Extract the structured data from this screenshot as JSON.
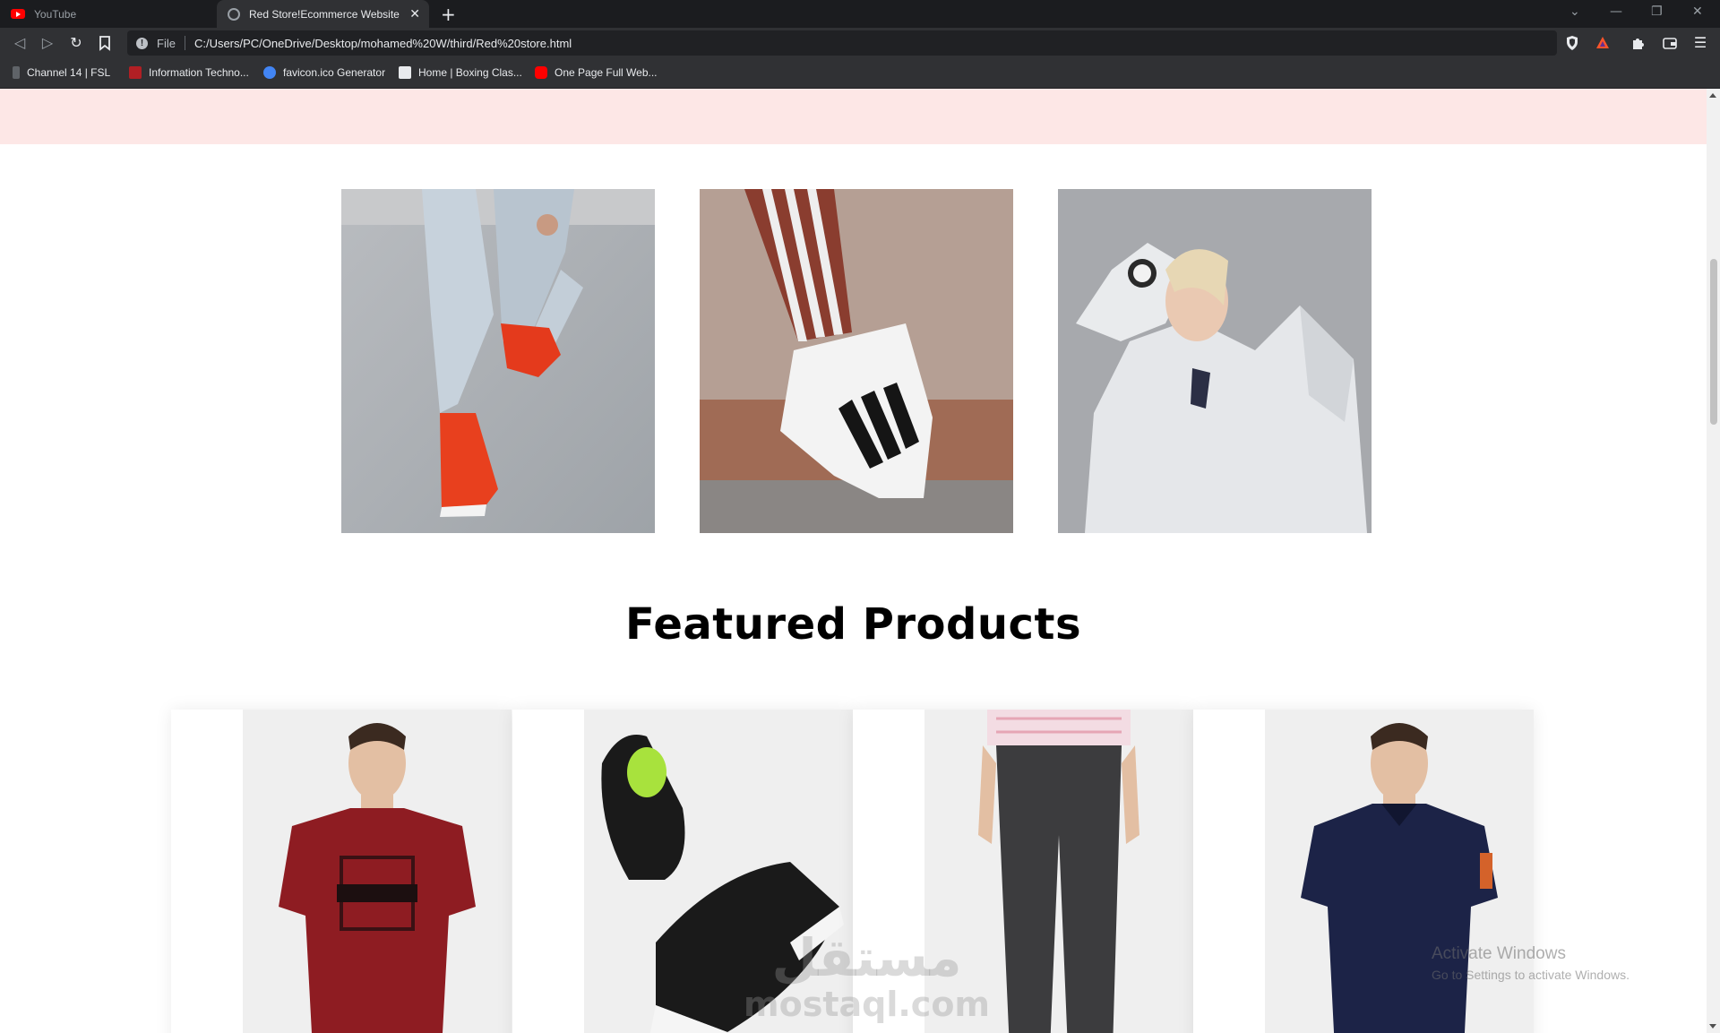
{
  "browser": {
    "tabs": [
      {
        "title": "YouTube",
        "active": false
      },
      {
        "title": "Red Store!Ecommerce Website",
        "active": true
      }
    ],
    "new_tab_glyph": "+",
    "close_glyph": "✕",
    "address": {
      "scheme_label": "File",
      "url": "C:/Users/PC/OneDrive/Desktop/mohamed%20W/third/Red%20store.html"
    },
    "bookmarks": [
      {
        "label": "Channel 14 | FSL",
        "icon": "channel-icon",
        "color": "#9aa0a6"
      },
      {
        "label": "Information Techno...",
        "icon": "it-icon",
        "color": "#b11f24"
      },
      {
        "label": "favicon.ico Generator",
        "icon": "favicon-generator-icon",
        "color": "#4285f4"
      },
      {
        "label": "Home | Boxing Clas...",
        "icon": "tbc-icon",
        "color": "#e8eaed"
      },
      {
        "label": "One Page Full Web...",
        "icon": "youtube-icon",
        "color": "#ff0000"
      }
    ]
  },
  "page": {
    "header_band_color": "#fde7e6",
    "categories": [
      {
        "name": "category-red-sneakers-image",
        "alt": "red sneakers"
      },
      {
        "name": "category-adidas-shoe-image",
        "alt": "adidas shoe"
      },
      {
        "name": "category-adidas-hoodie-image",
        "alt": "adidas hoodie"
      }
    ],
    "featured_title": "Featured Products",
    "products": [
      {
        "name": "product-red-tshirt",
        "color": "#8e1c22"
      },
      {
        "name": "product-black-shoes",
        "color": "#1a1a1a"
      },
      {
        "name": "product-grey-trousers",
        "color": "#3c3c3e"
      },
      {
        "name": "product-navy-polo",
        "color": "#1c2347"
      }
    ]
  },
  "overlay": {
    "windows_activation_title": "Activate Windows",
    "windows_activation_sub": "Go to Settings to activate Windows.",
    "watermark_arabic": "مستقل",
    "watermark_latin": "mostaql.com"
  }
}
